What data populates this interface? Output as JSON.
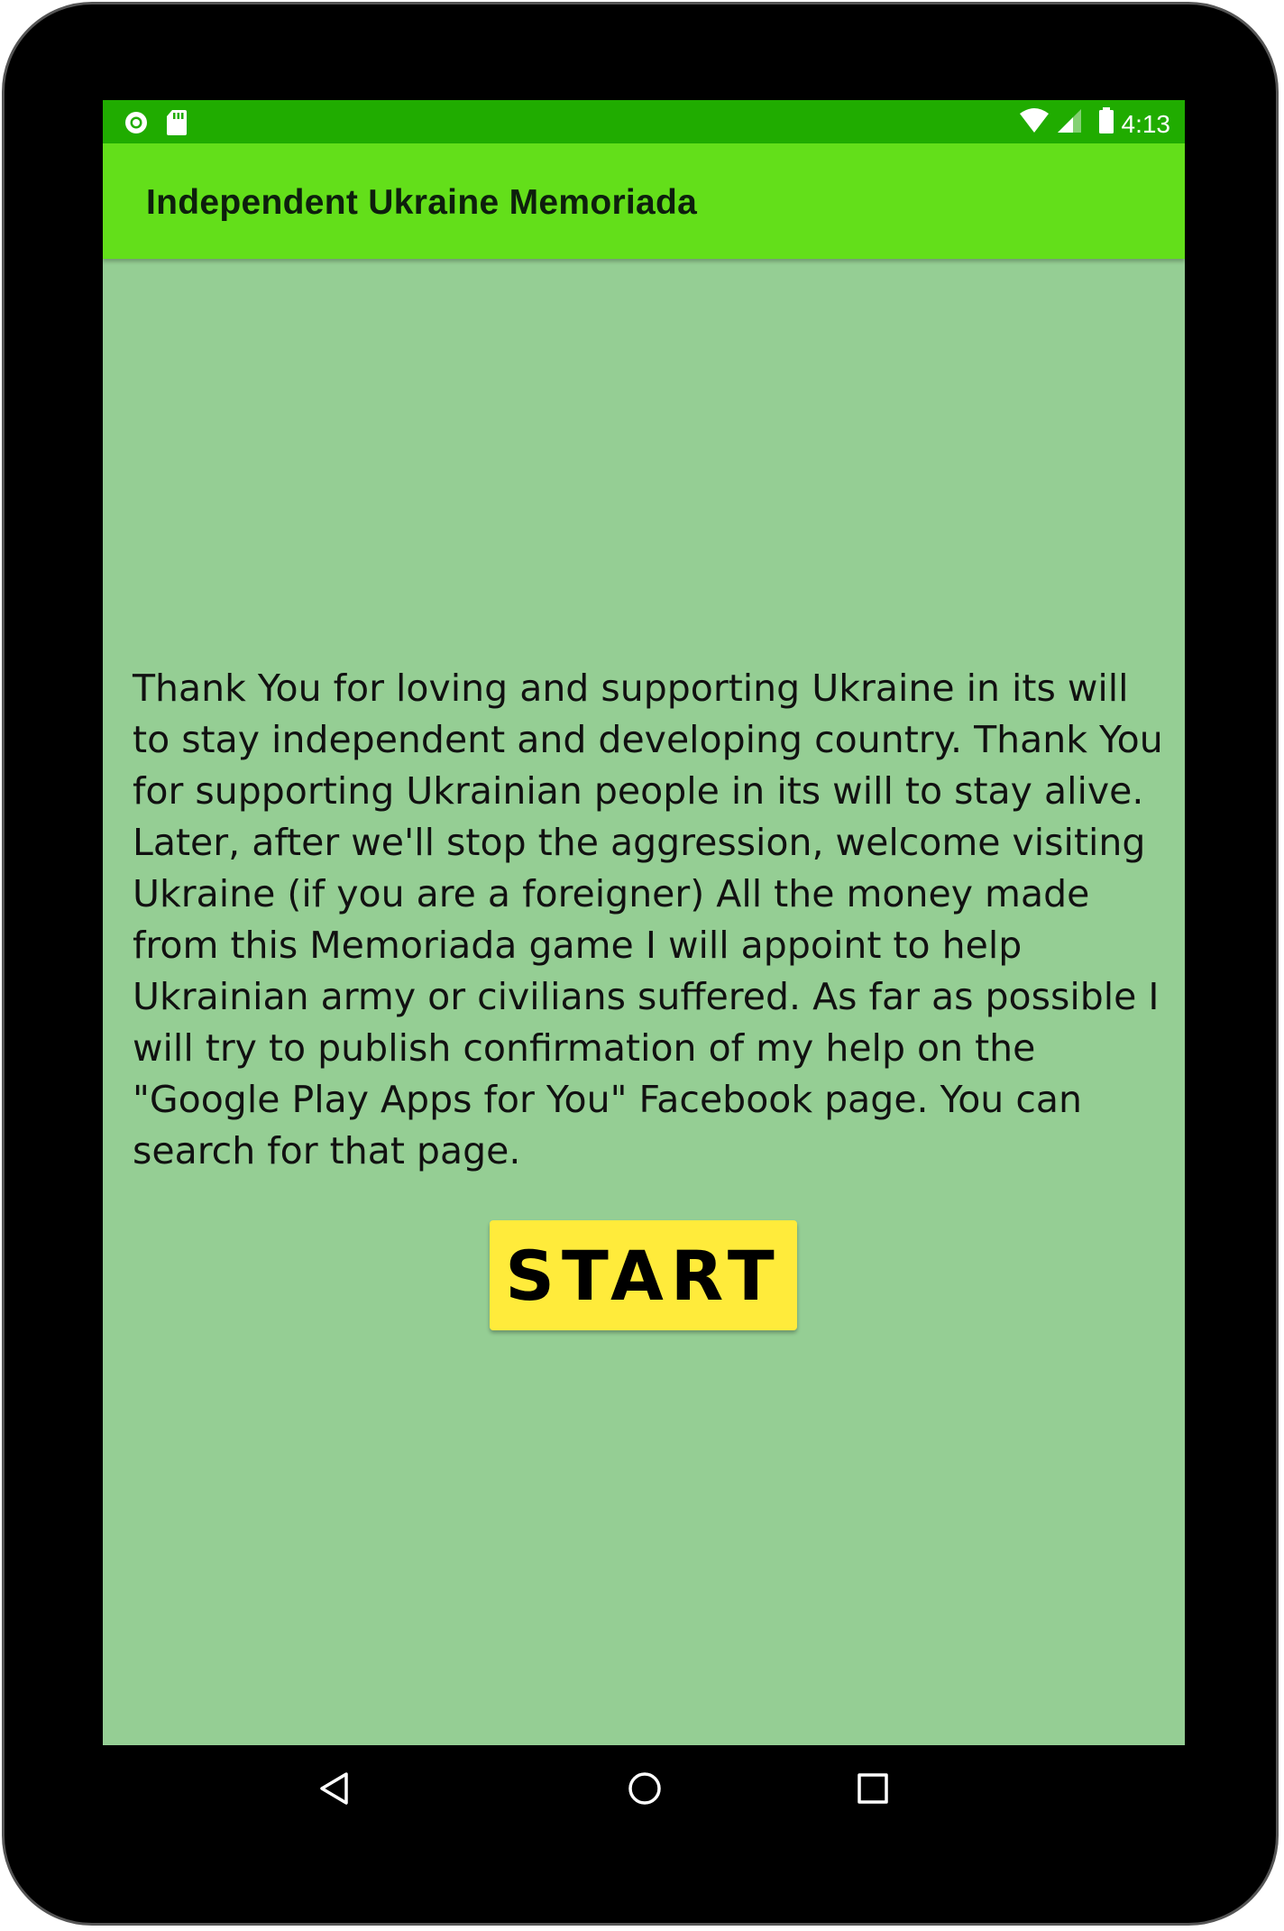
{
  "status_bar": {
    "time": "4:13",
    "icons": [
      "sync-icon",
      "sd-card-icon",
      "wifi-icon",
      "signal-icon",
      "battery-icon"
    ]
  },
  "app_bar": {
    "title": "Independent Ukraine Memoriada"
  },
  "main": {
    "message": "Thank You for loving and supporting Ukraine in its will to stay independent and developing country. Thank You for supporting Ukrainian people in its will to stay alive. Later, after we'll stop the aggression, welcome visiting Ukraine (if you are a foreigner) All the money made from this Memoriada game I will appoint to help Ukrainian army or civilians suffered. As far as possible I will try to publish confirmation of my help on the \"Google Play Apps for You\" Facebook page. You can search for that page.",
    "start_label": "START"
  },
  "nav_bar": {
    "icons": [
      "back-icon",
      "home-icon",
      "recents-icon"
    ]
  },
  "colors": {
    "status_bar": "#20ac00",
    "app_bar": "#63df1a",
    "background": "#95ce94",
    "button": "#ffeb3b",
    "device_frame": "#000000"
  }
}
